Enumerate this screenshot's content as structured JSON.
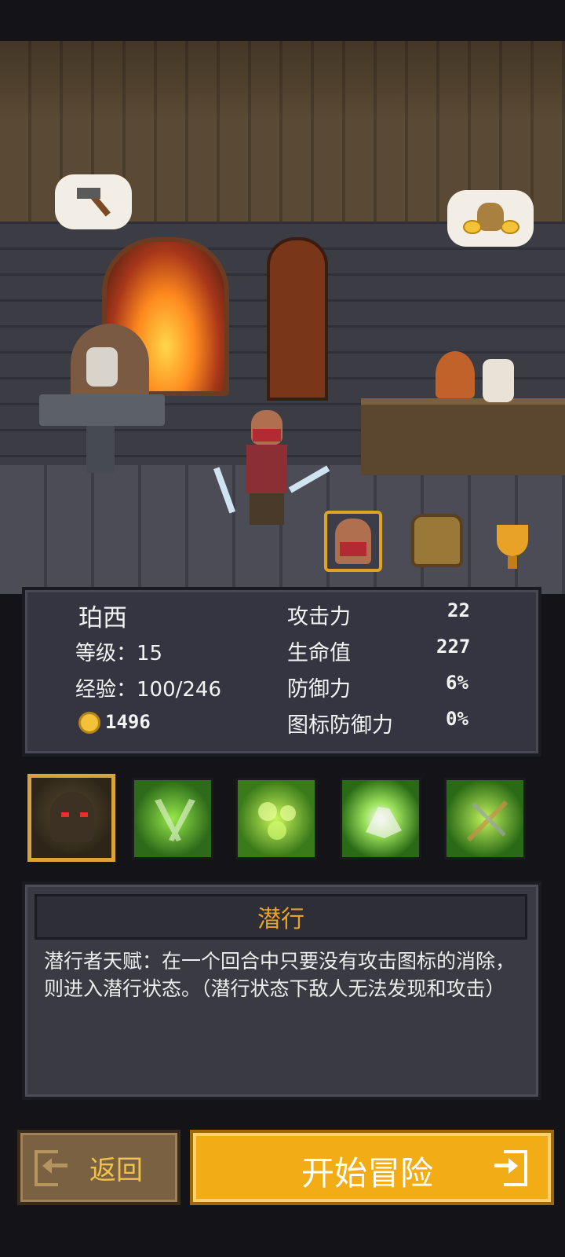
{
  "character": {
    "name": "珀西",
    "level_label": "等级：15",
    "exp_label": "经验：100/246",
    "gold": "1496"
  },
  "stats": [
    {
      "label": "攻击力",
      "value": "22"
    },
    {
      "label": "生命值",
      "value": "227"
    },
    {
      "label": "防御力",
      "value": "6%"
    },
    {
      "label": "图标防御力",
      "value": "0%"
    }
  ],
  "tabs": [
    {
      "icon": "character-portrait-icon",
      "selected": true
    },
    {
      "icon": "backpack-icon",
      "selected": false
    },
    {
      "icon": "trophy-icon",
      "selected": false
    }
  ],
  "skills": [
    {
      "icon": "hooded-figure-icon",
      "selected": true
    },
    {
      "icon": "crossed-blades-icon",
      "selected": false
    },
    {
      "icon": "green-clouds-icon",
      "selected": false
    },
    {
      "icon": "white-rock-icon",
      "selected": false
    },
    {
      "icon": "crossbow-icon",
      "selected": false
    }
  ],
  "skill_detail": {
    "title": "潜行",
    "description": "潜行者天赋：在一个回合中只要没有攻击图标的消除，则进入潜行状态。（潜行状态下敌人无法发现和攻击）"
  },
  "buttons": {
    "back_label": "返回",
    "start_label": "开始冒险"
  },
  "colors": {
    "accent": "#f2ad16",
    "title": "#e9a228",
    "panel": "#343540"
  }
}
